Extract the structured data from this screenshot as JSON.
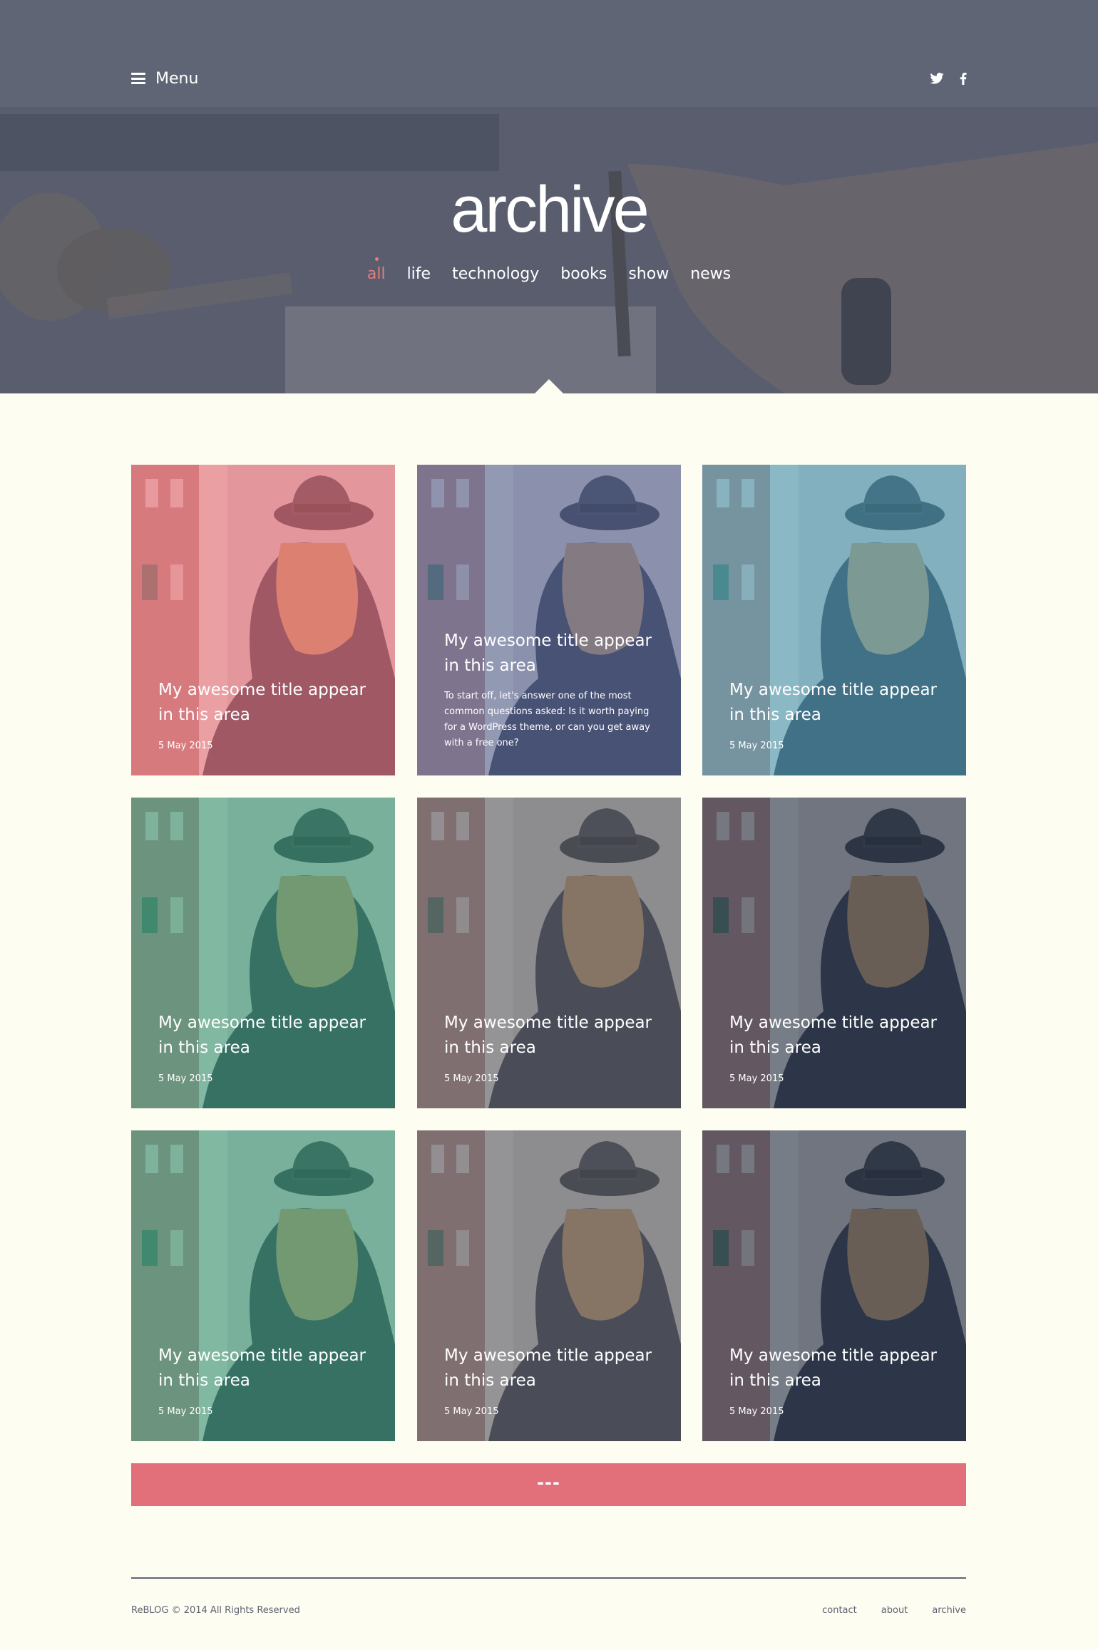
{
  "header": {
    "menu_label": "Menu",
    "page_title": "archive",
    "categories": [
      "all",
      "life",
      "technology",
      "books",
      "show",
      "news"
    ],
    "active_category": "all",
    "social_icons": [
      "twitter-icon",
      "facebook-icon"
    ]
  },
  "posts": [
    {
      "title": "My awesome title appear in this area",
      "date": "5 May 2015",
      "tint": "#e8717d"
    },
    {
      "title": "My awesome title appear in this area",
      "excerpt": "To start off, let's answer one of the most common questions asked: Is it worth paying for a WordPress theme, or can you get away with a free one?",
      "date": "",
      "tint": "#5a6796"
    },
    {
      "title": "My awesome title appear in this area",
      "date": "5 May 2015",
      "tint": "#4e9ab3"
    },
    {
      "title": "My awesome title appear in this area",
      "date": "5 May 2015",
      "tint": "#3d9a7a"
    },
    {
      "title": "My awesome title appear in this area",
      "date": "5 May 2015",
      "tint": "#5d5f68"
    },
    {
      "title": "My awesome title appear in this area",
      "date": "5 May 2015",
      "tint": "#2f3a4e"
    },
    {
      "title": "My awesome title appear in this area",
      "date": "5 May 2015",
      "tint": "#3d9a7a"
    },
    {
      "title": "My awesome title appear in this area",
      "date": "5 May 2015",
      "tint": "#5d5f68"
    },
    {
      "title": "My awesome title appear in this area",
      "date": "5 May 2015",
      "tint": "#2f3a4e"
    }
  ],
  "load_more": {
    "label": "---",
    "color": "#e2707a"
  },
  "footer": {
    "copyright": "ReBLOG  © 2014  All Rights Reserved",
    "links": [
      "contact",
      "about",
      "archive"
    ]
  },
  "colors": {
    "background": "#fdfdf1",
    "accent": "#e47d7f"
  }
}
